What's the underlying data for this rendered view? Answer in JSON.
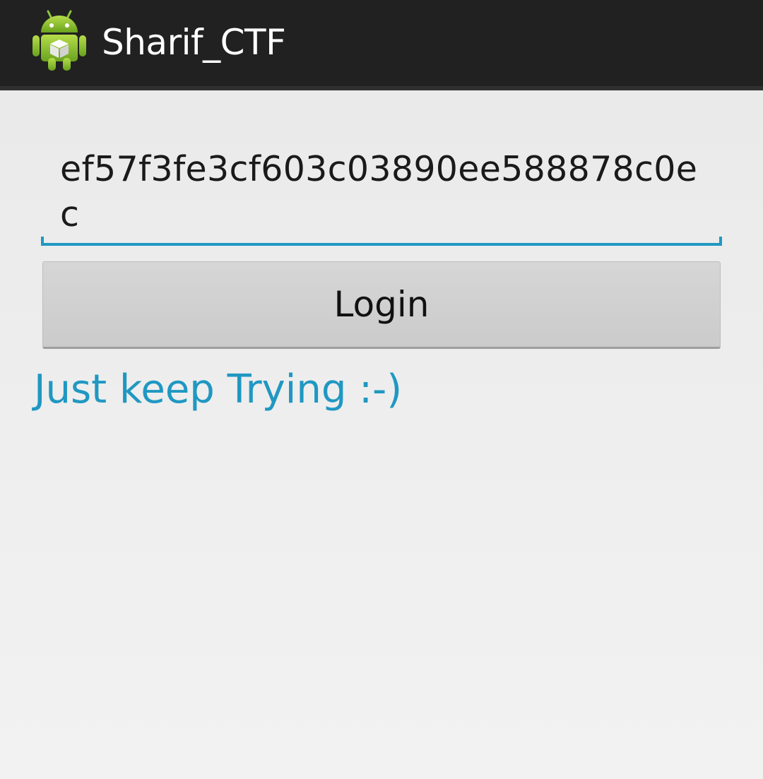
{
  "app": {
    "title": "Sharif_CTF",
    "icon": "android-robot-icon"
  },
  "form": {
    "input_value": "ef57f3fe3cf603c03890ee588878c0ec",
    "login_label": "Login",
    "status_message": "Just keep Trying :-)"
  },
  "colors": {
    "action_bar": "#212121",
    "accent": "#1f98c2",
    "button": "#cbcbcb",
    "background": "#ececec"
  }
}
